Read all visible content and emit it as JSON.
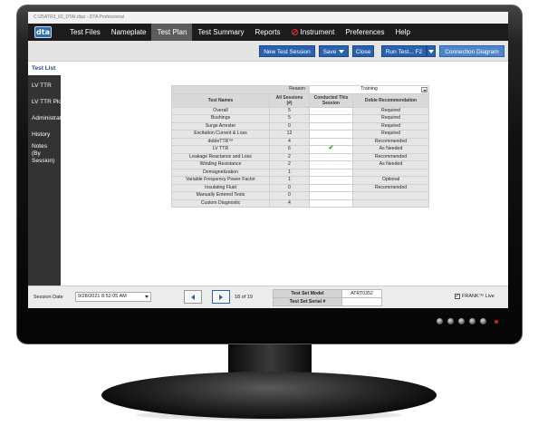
{
  "window": {
    "title": "C:\\25ATR3_63_DTAI.dtaz - DTA Professional"
  },
  "logo": {
    "text": "dta"
  },
  "menu": {
    "items": [
      "Test Files",
      "Nameplate",
      "Test Plan",
      "Test Summary",
      "Reports",
      "Instrument",
      "Preferences",
      "Help"
    ],
    "active_index": 2
  },
  "toolbar": {
    "new_session": "New Test Session",
    "save": "Save",
    "close": "Close",
    "run_test": "Run Test...",
    "run_test_key": "F2",
    "connection_diagram": "Connection Diagram"
  },
  "sidebar": {
    "items": [
      "Test List",
      "LV TTR",
      "LV TTR Plots",
      "Administration",
      "History",
      "Notes\n(By Session)"
    ],
    "notes_line1": "Notes",
    "notes_line2": "(By Session)",
    "active_index": 0
  },
  "grid": {
    "reason_label": "Reason",
    "reason_value": "Training",
    "headers": {
      "test_names": "Test Names",
      "all_sessions": "All Sessions",
      "all_sessions_sub": "(#)",
      "conducted": "Conducted This",
      "conducted_sub": "Session",
      "recommendation": "Doble Recommendation"
    },
    "rows": [
      {
        "name": "Overall",
        "count": "5",
        "conducted": "",
        "rec": "Required"
      },
      {
        "name": "Bushings",
        "count": "5",
        "conducted": "",
        "rec": "Required"
      },
      {
        "name": "Surge Arrester",
        "count": "0",
        "conducted": "",
        "rec": "Required"
      },
      {
        "name": "Excitation Current & Loss",
        "count": "12",
        "conducted": "",
        "rec": "Required"
      },
      {
        "name": "dobleTTR™",
        "count": "4",
        "conducted": "",
        "rec": "Recommended"
      },
      {
        "name": "LV TTR",
        "count": "6",
        "conducted": "✔",
        "rec": "As Needed"
      },
      {
        "name": "Leakage Reactance and Loss",
        "count": "2",
        "conducted": "",
        "rec": "Recommended"
      },
      {
        "name": "Winding Resistance",
        "count": "2",
        "conducted": "",
        "rec": "As Needed"
      },
      {
        "name": "Demagnetization",
        "count": "1",
        "conducted": "",
        "rec": ""
      },
      {
        "name": "Variable Frequency Power Factor",
        "count": "1",
        "conducted": "",
        "rec": "Optional"
      },
      {
        "name": "Insulating Fluid",
        "count": "0",
        "conducted": "",
        "rec": "Recommended"
      },
      {
        "name": "Manually Entered Tests",
        "count": "0",
        "conducted": "",
        "rec": ""
      },
      {
        "name": "Custom Diagnostic",
        "count": "4",
        "conducted": "",
        "rec": ""
      }
    ]
  },
  "footer": {
    "session_label": "Session Date",
    "session_date": "9/28/2021 8:52:05 AM",
    "page_count": "18 of 19",
    "test_set_model_label": "Test Set Model",
    "test_set_model": "ATRT0352",
    "test_set_serial_label": "Test Set Serial #",
    "test_set_serial": "",
    "frank_label": "FRANK™ Live",
    "frank_checked": true
  },
  "colors": {
    "accent": "#2a63ad",
    "menubar": "#1c1c1c",
    "sidebar": "#333333",
    "check": "#2aa02a"
  },
  "icons": [
    "no-entry-icon",
    "dropdown-caret-icon",
    "prev-arrow-icon",
    "next-arrow-icon",
    "check-icon",
    "checkbox-icon"
  ]
}
